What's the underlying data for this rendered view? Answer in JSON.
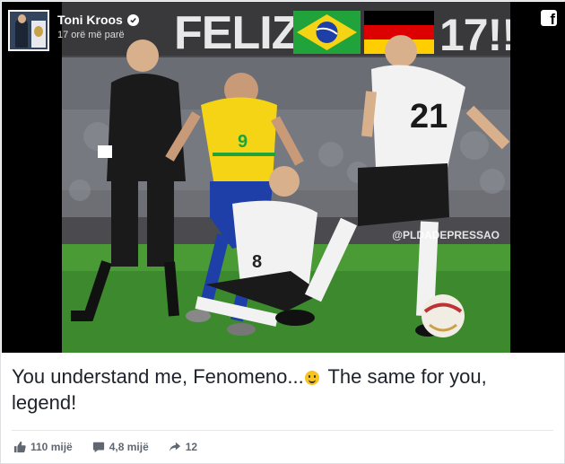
{
  "post": {
    "author": "Toni Kroos",
    "timestamp": "17 orë më parë",
    "caption": {
      "before_emoji": "You understand me, Fenomeno...",
      "after_emoji": " The same for you, legend!"
    },
    "emoji": "smiley-icon"
  },
  "image": {
    "headline_left": "FELIZ",
    "headline_right": "17!!",
    "watermark": "@PLDADEPRESSAO",
    "flags": [
      "brazil-flag",
      "germany-flag"
    ],
    "jersey_numbers": {
      "brazil": "9",
      "germany_front": "8",
      "germany_back": "21"
    }
  },
  "stats": {
    "likes": "110 mijë",
    "comments": "4,8 mijë",
    "shares": "12"
  },
  "colors": {
    "brazil_yellow": "#f5d415",
    "brazil_blue": "#1f3fa8",
    "pitch_green": "#3d8a2e",
    "caption_text": "#1d2129",
    "meta_gray": "#606770"
  }
}
